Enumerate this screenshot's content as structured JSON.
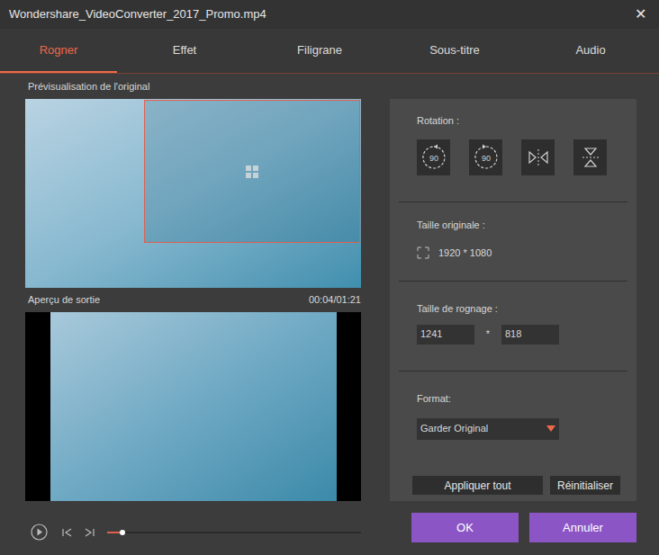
{
  "window": {
    "title": "Wondershare_VideoConverter_2017_Promo.mp4",
    "close": "✕"
  },
  "tabs": [
    {
      "label": "Rogner",
      "selected": true
    },
    {
      "label": "Effet",
      "selected": false
    },
    {
      "label": "Filigrane",
      "selected": false
    },
    {
      "label": "Sous-titre",
      "selected": false
    },
    {
      "label": "Audio",
      "selected": false
    }
  ],
  "original_preview": {
    "label": "Prévisualisation de l'original"
  },
  "output_preview": {
    "label": "Aperçu de sortie",
    "time": "00:04/01:21"
  },
  "player": {
    "level": 0.06
  },
  "rotation": {
    "label": "Rotation :",
    "buttons": [
      {
        "kind": "rotate-left",
        "text": "90"
      },
      {
        "kind": "rotate-right",
        "text": "90"
      },
      {
        "kind": "flip-horizontal",
        "text": ""
      },
      {
        "kind": "flip-vertical",
        "text": ""
      }
    ]
  },
  "original_size": {
    "label": "Taille originale :",
    "value": "1920 * 1080"
  },
  "crop_size": {
    "label": "Taille de rognage :",
    "width": "1241",
    "separator": "*",
    "height": "818"
  },
  "format": {
    "label": "Format:",
    "value": "Garder Original"
  },
  "actions": [
    "Appliquer tout",
    "Réinitialiser"
  ],
  "buttons": [
    "OK",
    "Annuler"
  ]
}
